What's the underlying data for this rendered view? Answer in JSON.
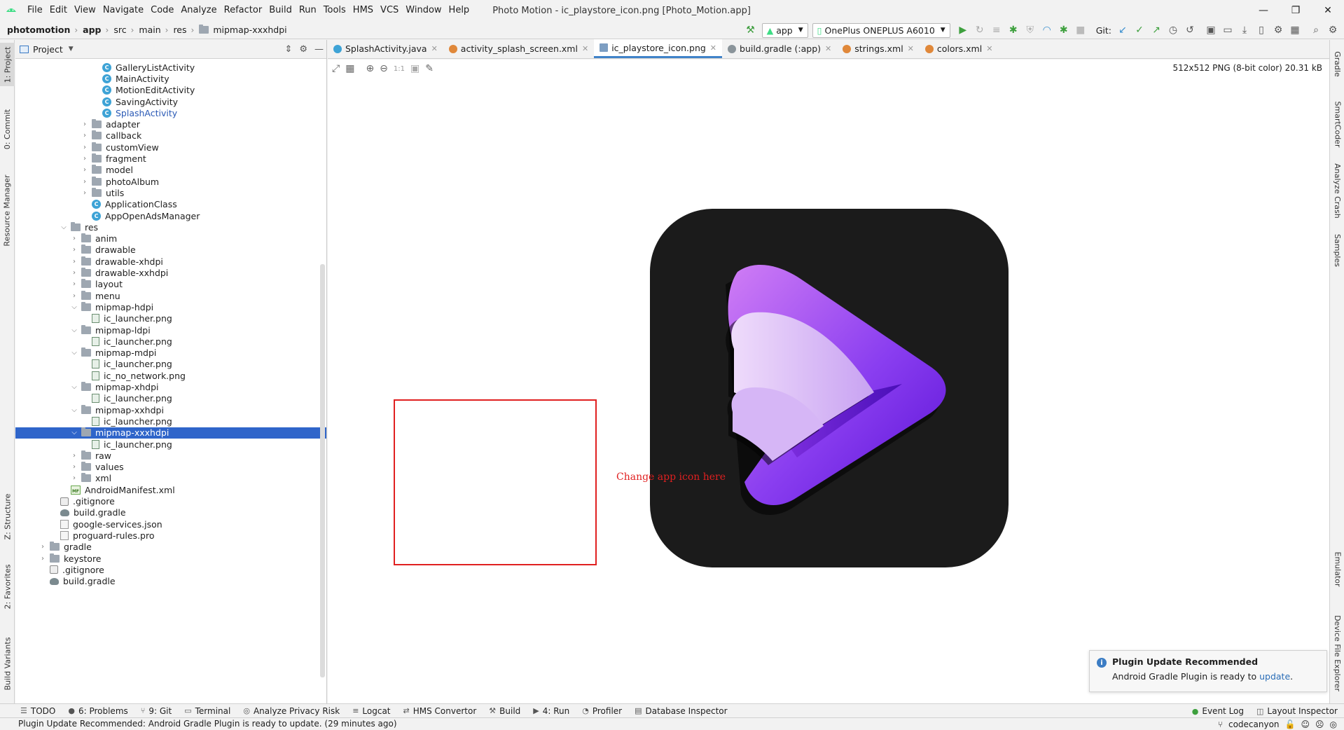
{
  "menubar": {
    "items": [
      "File",
      "Edit",
      "View",
      "Navigate",
      "Code",
      "Analyze",
      "Refactor",
      "Build",
      "Run",
      "Tools",
      "HMS",
      "VCS",
      "Window",
      "Help"
    ],
    "window_title": "Photo Motion - ic_playstore_icon.png [Photo_Motion.app]"
  },
  "navbar": {
    "breadcrumbs": [
      "photomotion",
      "app",
      "src",
      "main",
      "res",
      "mipmap-xxxhdpi"
    ],
    "run_config": "app",
    "device": "OnePlus ONEPLUS A6010",
    "git_label": "Git:"
  },
  "left_strip": {
    "tabs": [
      "1: Project",
      "0: Commit",
      "Resource Manager",
      "Z: Structure",
      "2: Favorites",
      "Build Variants"
    ]
  },
  "right_strip": {
    "tabs": [
      "Gradle",
      "SmartCoder",
      "Analyze Crash",
      "Samples",
      "Emulator",
      "Device File Explorer"
    ]
  },
  "project": {
    "header_label": "Project",
    "tree": [
      {
        "label": "GalleryListActivity",
        "type": "class",
        "indent": 4,
        "chev": ""
      },
      {
        "label": "MainActivity",
        "type": "class",
        "indent": 4,
        "chev": ""
      },
      {
        "label": "MotionEditActivity",
        "type": "class",
        "indent": 4,
        "chev": ""
      },
      {
        "label": "SavingActivity",
        "type": "class",
        "indent": 4,
        "chev": ""
      },
      {
        "label": "SplashActivity",
        "type": "class-link",
        "indent": 4,
        "chev": ""
      },
      {
        "label": "adapter",
        "type": "folder",
        "indent": 3,
        "chev": "›"
      },
      {
        "label": "callback",
        "type": "folder",
        "indent": 3,
        "chev": "›"
      },
      {
        "label": "customView",
        "type": "folder",
        "indent": 3,
        "chev": "›"
      },
      {
        "label": "fragment",
        "type": "folder",
        "indent": 3,
        "chev": "›"
      },
      {
        "label": "model",
        "type": "folder",
        "indent": 3,
        "chev": "›"
      },
      {
        "label": "photoAlbum",
        "type": "folder",
        "indent": 3,
        "chev": "›"
      },
      {
        "label": "utils",
        "type": "folder",
        "indent": 3,
        "chev": "›"
      },
      {
        "label": "ApplicationClass",
        "type": "class",
        "indent": 3,
        "chev": ""
      },
      {
        "label": "AppOpenAdsManager",
        "type": "class",
        "indent": 3,
        "chev": ""
      },
      {
        "label": "res",
        "type": "folder",
        "indent": 1,
        "chev": "⌄"
      },
      {
        "label": "anim",
        "type": "folder",
        "indent": 2,
        "chev": "›"
      },
      {
        "label": "drawable",
        "type": "folder",
        "indent": 2,
        "chev": "›"
      },
      {
        "label": "drawable-xhdpi",
        "type": "folder",
        "indent": 2,
        "chev": "›"
      },
      {
        "label": "drawable-xxhdpi",
        "type": "folder",
        "indent": 2,
        "chev": "›"
      },
      {
        "label": "layout",
        "type": "folder",
        "indent": 2,
        "chev": "›"
      },
      {
        "label": "menu",
        "type": "folder",
        "indent": 2,
        "chev": "›"
      },
      {
        "label": "mipmap-hdpi",
        "type": "folder",
        "indent": 2,
        "chev": "⌄"
      },
      {
        "label": "ic_launcher.png",
        "type": "file",
        "indent": 3,
        "chev": ""
      },
      {
        "label": "mipmap-ldpi",
        "type": "folder",
        "indent": 2,
        "chev": "⌄"
      },
      {
        "label": "ic_launcher.png",
        "type": "file",
        "indent": 3,
        "chev": ""
      },
      {
        "label": "mipmap-mdpi",
        "type": "folder",
        "indent": 2,
        "chev": "⌄"
      },
      {
        "label": "ic_launcher.png",
        "type": "file",
        "indent": 3,
        "chev": ""
      },
      {
        "label": "ic_no_network.png",
        "type": "file",
        "indent": 3,
        "chev": ""
      },
      {
        "label": "mipmap-xhdpi",
        "type": "folder",
        "indent": 2,
        "chev": "⌄"
      },
      {
        "label": "ic_launcher.png",
        "type": "file",
        "indent": 3,
        "chev": ""
      },
      {
        "label": "mipmap-xxhdpi",
        "type": "folder",
        "indent": 2,
        "chev": "⌄"
      },
      {
        "label": "ic_launcher.png",
        "type": "file",
        "indent": 3,
        "chev": ""
      },
      {
        "label": "mipmap-xxxhdpi",
        "type": "folder",
        "indent": 2,
        "chev": "⌄",
        "selected": true
      },
      {
        "label": "ic_launcher.png",
        "type": "file",
        "indent": 3,
        "chev": ""
      },
      {
        "label": "raw",
        "type": "folder",
        "indent": 2,
        "chev": "›"
      },
      {
        "label": "values",
        "type": "folder",
        "indent": 2,
        "chev": "›"
      },
      {
        "label": "xml",
        "type": "folder",
        "indent": 2,
        "chev": "›"
      },
      {
        "label": "AndroidManifest.xml",
        "type": "manifest",
        "indent": 1,
        "chev": ""
      },
      {
        "label": ".gitignore",
        "type": "git",
        "indent": 0,
        "chev": ""
      },
      {
        "label": "build.gradle",
        "type": "gradle",
        "indent": 0,
        "chev": ""
      },
      {
        "label": "google-services.json",
        "type": "json",
        "indent": 0,
        "chev": ""
      },
      {
        "label": "proguard-rules.pro",
        "type": "json",
        "indent": 0,
        "chev": ""
      },
      {
        "label": "gradle",
        "type": "folder",
        "indent": -1,
        "chev": "›"
      },
      {
        "label": "keystore",
        "type": "folder",
        "indent": -1,
        "chev": "›"
      },
      {
        "label": ".gitignore",
        "type": "git",
        "indent": -1,
        "chev": ""
      },
      {
        "label": "build.gradle",
        "type": "gradle",
        "indent": -1,
        "chev": ""
      }
    ]
  },
  "editor": {
    "tabs": [
      {
        "label": "SplashActivity.java",
        "icon": "class",
        "active": false
      },
      {
        "label": "activity_splash_screen.xml",
        "icon": "xml",
        "active": false
      },
      {
        "label": "ic_playstore_icon.png",
        "icon": "image",
        "active": true
      },
      {
        "label": "build.gradle (:app)",
        "icon": "gradle",
        "active": false
      },
      {
        "label": "strings.xml",
        "icon": "xml",
        "active": false
      },
      {
        "label": "colors.xml",
        "icon": "xml",
        "active": false
      }
    ],
    "image_toolbar_zoom_label": "1:1",
    "image_info": "512x512 PNG (8-bit color) 20.31 kB",
    "callout_text": "Change app icon here"
  },
  "notification": {
    "title": "Plugin Update Recommended",
    "body_prefix": "Android Gradle Plugin is ready to ",
    "link": "update",
    "body_suffix": "."
  },
  "toolwindows": {
    "left": [
      {
        "icon": "☰",
        "label": "TODO"
      },
      {
        "icon": "●",
        "label": "6: Problems"
      },
      {
        "icon": "⑂",
        "label": "9: Git"
      },
      {
        "icon": "▭",
        "label": "Terminal"
      },
      {
        "icon": "◎",
        "label": "Analyze Privacy Risk"
      },
      {
        "icon": "≡",
        "label": "Logcat"
      },
      {
        "icon": "⇄",
        "label": "HMS Convertor"
      },
      {
        "icon": "⚒",
        "label": "Build"
      },
      {
        "icon": "▶",
        "label": "4: Run"
      },
      {
        "icon": "◔",
        "label": "Profiler"
      },
      {
        "icon": "▤",
        "label": "Database Inspector"
      }
    ],
    "right": [
      {
        "icon": "●",
        "label": "Event Log"
      },
      {
        "icon": "◫",
        "label": "Layout Inspector"
      }
    ]
  },
  "statusbar": {
    "text": "Plugin Update Recommended: Android Gradle Plugin is ready to update. (29 minutes ago)",
    "branch": "codecanyon"
  },
  "colors": {
    "selection": "#2f65ca",
    "callout": "#e02020",
    "icon_bg": "#1b1b1b",
    "icon_purple": "#7a2ee0"
  }
}
